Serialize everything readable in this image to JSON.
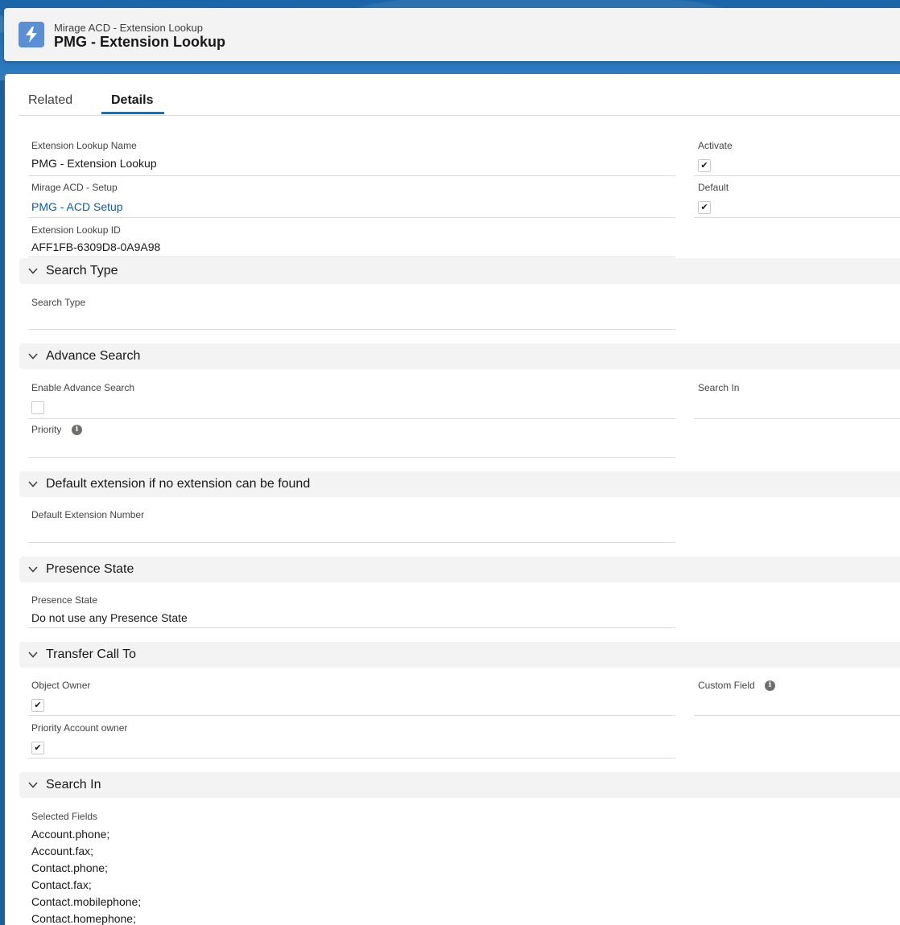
{
  "header": {
    "object_label": "Mirage ACD - Extension Lookup",
    "record_name": "PMG - Extension Lookup",
    "icon": "lightning-icon"
  },
  "tabs": [
    {
      "label": "Related",
      "active": false
    },
    {
      "label": "Details",
      "active": true
    }
  ],
  "top_fields": {
    "extension_lookup_name": {
      "label": "Extension Lookup Name",
      "value": "PMG - Extension Lookup"
    },
    "activate": {
      "label": "Activate",
      "checked": true
    },
    "mirage_acd_setup": {
      "label": "Mirage ACD - Setup",
      "value": "PMG - ACD Setup"
    },
    "default": {
      "label": "Default",
      "checked": true
    },
    "extension_lookup_id": {
      "label": "Extension Lookup ID",
      "value": "AFF1FB-6309D8-0A9A98"
    }
  },
  "sections": {
    "search_type": {
      "title": "Search Type",
      "field_label": "Search Type",
      "field_value": ""
    },
    "advance_search": {
      "title": "Advance Search",
      "enable_label": "Enable Advance Search",
      "enable_checked": false,
      "search_in_label": "Search In",
      "priority_label": "Priority"
    },
    "default_extension": {
      "title": "Default extension if no extension can be found",
      "field_label": "Default Extension Number",
      "field_value": ""
    },
    "presence_state": {
      "title": "Presence State",
      "field_label": "Presence State",
      "field_value": "Do not use any Presence State"
    },
    "transfer_call_to": {
      "title": "Transfer Call To",
      "object_owner_label": "Object Owner",
      "object_owner_checked": true,
      "custom_field_label": "Custom Field",
      "priority_account_owner_label": "Priority Account owner",
      "priority_account_owner_checked": true
    },
    "search_in": {
      "title": "Search In",
      "selected_fields_label": "Selected Fields",
      "selected_fields": [
        "Account.phone;",
        "Account.fax;",
        "Contact.phone;",
        "Contact.fax;",
        "Contact.mobilephone;",
        "Contact.homephone;"
      ]
    }
  },
  "colors": {
    "brand_blue": "#0176d3",
    "link": "#0b5cab",
    "icon_bg": "#5a8fd6",
    "section_bg": "#f3f3f3"
  }
}
